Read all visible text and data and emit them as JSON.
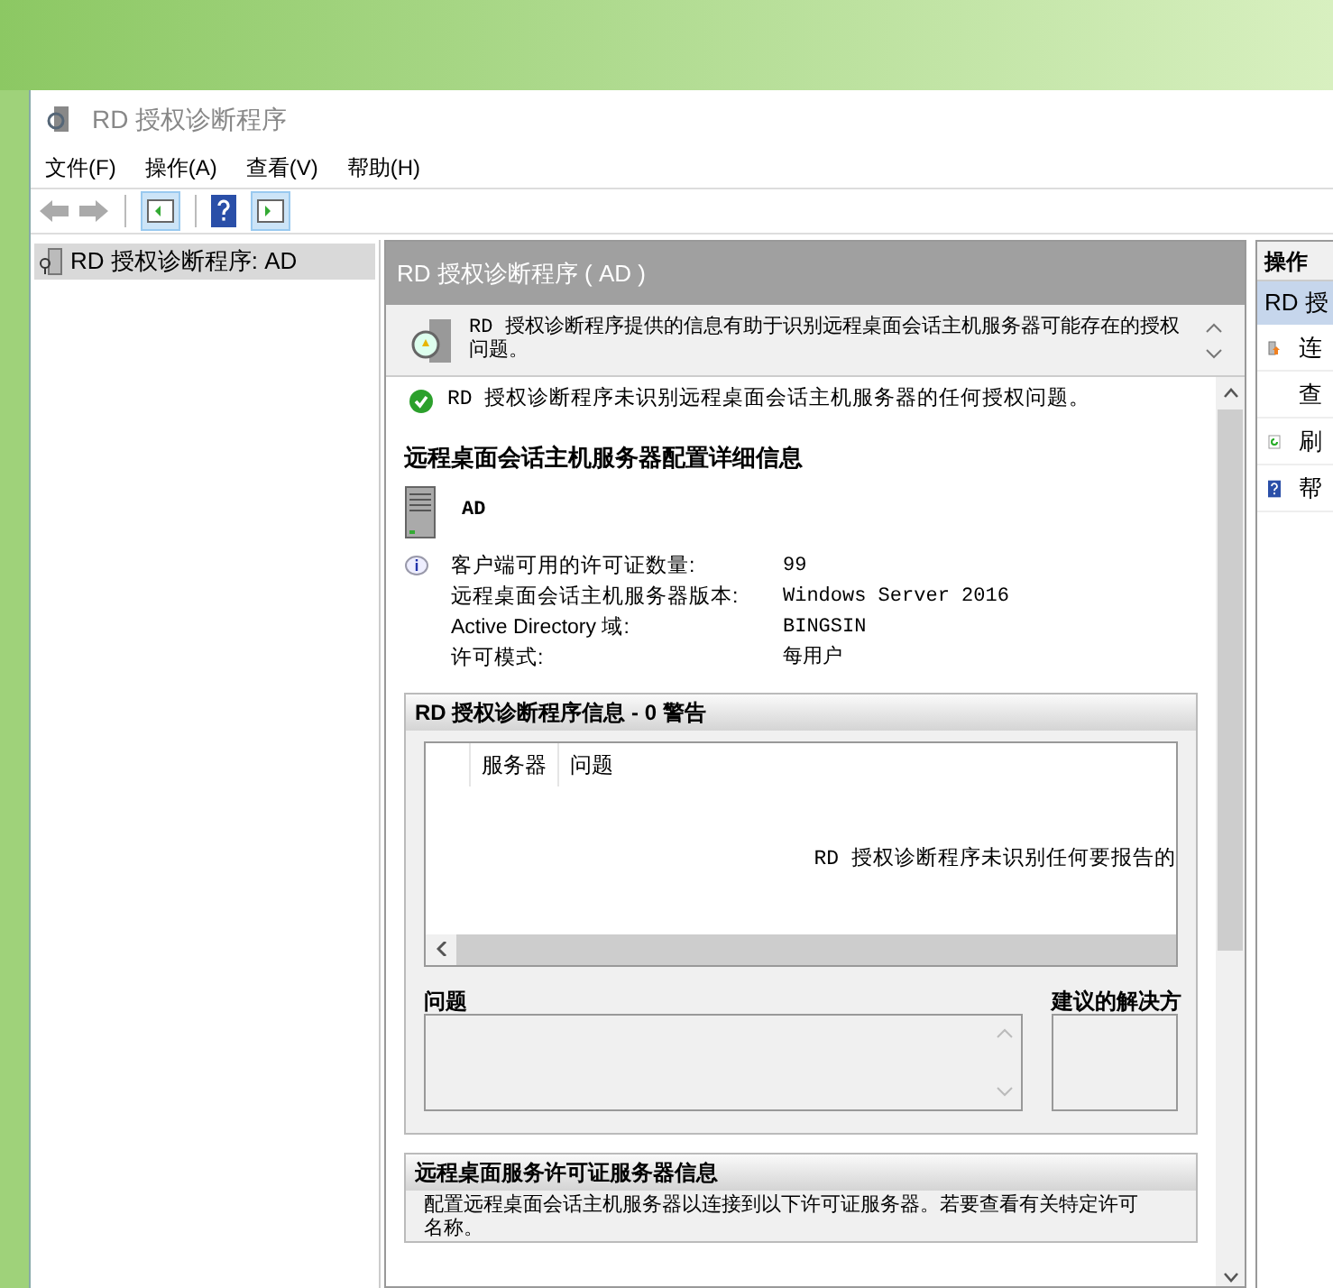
{
  "window": {
    "title": "RD 授权诊断程序"
  },
  "menu": [
    "文件(F)",
    "操作(A)",
    "查看(V)",
    "帮助(H)"
  ],
  "tree": {
    "items": [
      {
        "label": "RD 授权诊断程序: AD",
        "selected": true
      }
    ]
  },
  "center": {
    "header": "RD 授权诊断程序 ( AD )",
    "description": "RD 授权诊断程序提供的信息有助于识别远程桌面会话主机服务器可能存在的授权问题。",
    "status": "RD 授权诊断程序未识别远程桌面会话主机服务器的任何授权问题。",
    "details_heading": "远程桌面会话主机服务器配置详细信息",
    "server_name": "AD",
    "properties": [
      {
        "label": "客户端可用的许可证数量:",
        "value": "99"
      },
      {
        "label": "远程桌面会话主机服务器版本:",
        "value": "Windows Server 2016"
      },
      {
        "label": "Active Directory 域:",
        "value": "BINGSIN"
      },
      {
        "label": "许可模式:",
        "value": "每用户"
      }
    ],
    "warnings_section": {
      "title": "RD 授权诊断程序信息 - 0 警告",
      "columns": [
        "服务器",
        "问题"
      ],
      "empty_message": "RD 授权诊断程序未识别任何要报告的",
      "problem_label": "问题",
      "solution_label": "建议的解决方"
    },
    "license_section": {
      "title": "远程桌面服务许可证服务器信息",
      "lines": [
        "配置远程桌面会话主机服务器以连接到以下许可证服务器。若要查看有关特定许可",
        "名称。"
      ]
    }
  },
  "actions": {
    "title": "操作",
    "items": [
      {
        "kind": "header",
        "label": "RD 授"
      },
      {
        "kind": "connect",
        "label": "连"
      },
      {
        "kind": "plain",
        "label": "查"
      },
      {
        "kind": "refresh",
        "label": "刷"
      },
      {
        "kind": "help",
        "label": "帮"
      }
    ]
  }
}
